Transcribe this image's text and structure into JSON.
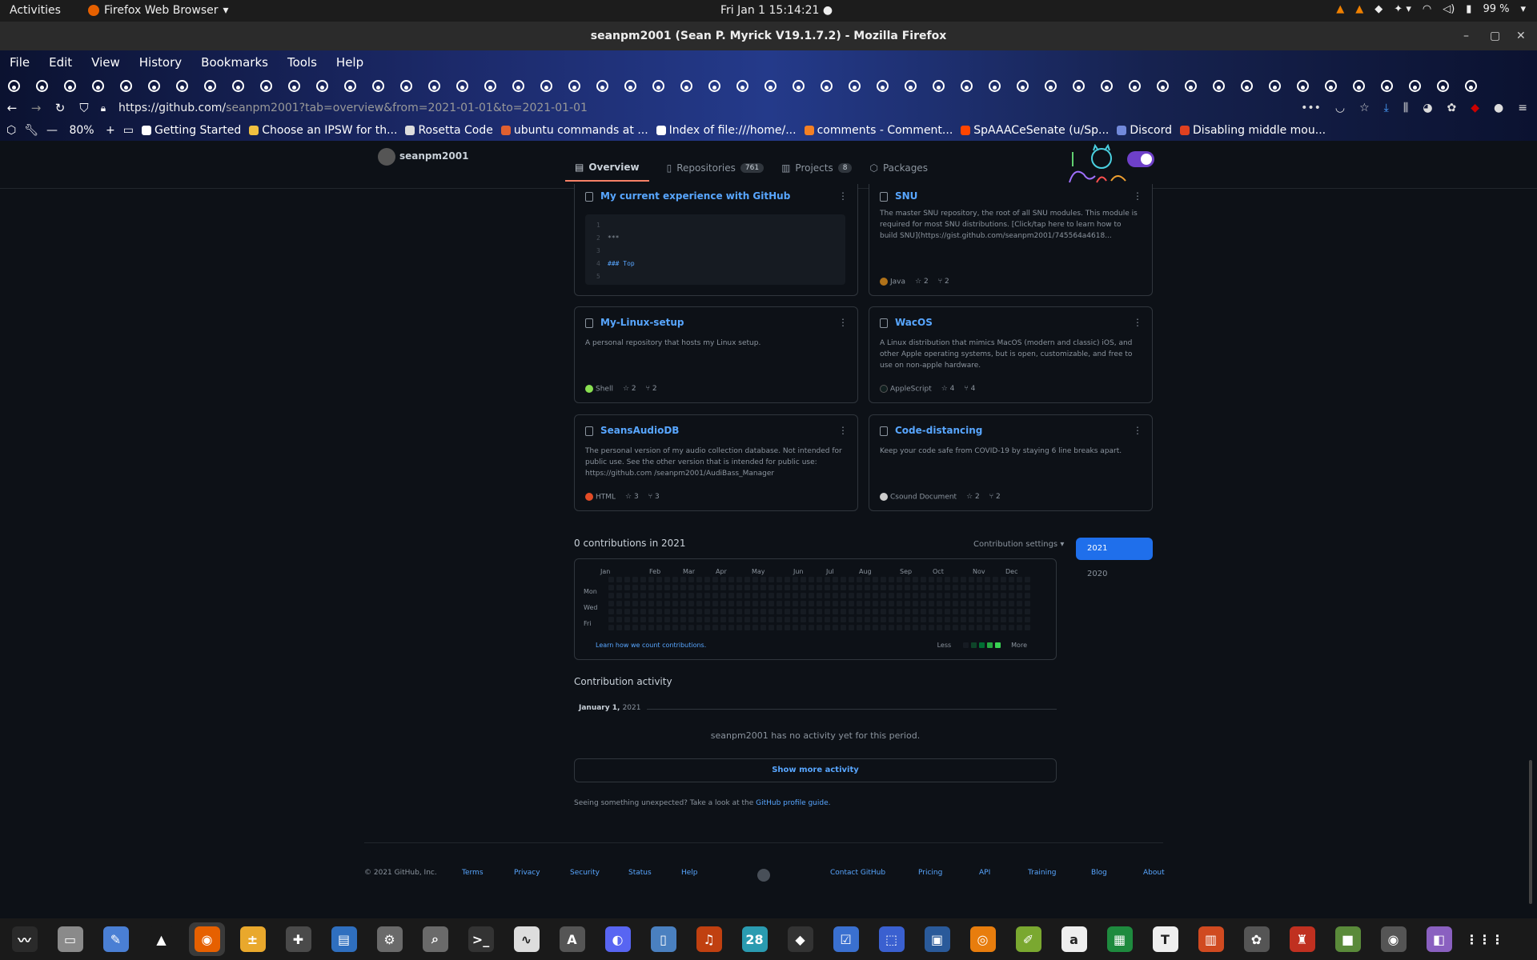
{
  "topbar": {
    "activities": "Activities",
    "app_name": "Firefox Web Browser",
    "clock": "Fri Jan 1  15:14:21",
    "battery": "99 %"
  },
  "window": {
    "title": "seanpm2001 (Sean P. Myrick V19.1.7.2) - Mozilla Firefox"
  },
  "menubar": [
    "File",
    "Edit",
    "View",
    "History",
    "Bookmarks",
    "Tools",
    "Help"
  ],
  "navbar": {
    "url_host": "https://github.com/",
    "url_path": "seanpm2001?tab=overview&from=2021-01-01&to=2021-01-01",
    "zoom": "80%"
  },
  "bookmarks": [
    {
      "label": "Getting Started",
      "color": "#ffffff"
    },
    {
      "label": "Choose an IPSW for th...",
      "color": "#f0c040"
    },
    {
      "label": "Rosetta Code",
      "color": "#dddddd"
    },
    {
      "label": "ubuntu commands at ...",
      "color": "#e06030"
    },
    {
      "label": "Index of file:///home/...",
      "color": "#ffffff"
    },
    {
      "label": "comments - Comment...",
      "color": "#f48024"
    },
    {
      "label": "SpAAACeSenate (u/Sp...",
      "color": "#ff4500"
    },
    {
      "label": "Discord",
      "color": "#7289da"
    },
    {
      "label": "Disabling middle mou...",
      "color": "#e04020"
    }
  ],
  "profile": {
    "username": "seanpm2001",
    "tabs": [
      {
        "label": "Overview"
      },
      {
        "label": "Repositories",
        "count": "761"
      },
      {
        "label": "Projects",
        "count": "8"
      },
      {
        "label": "Packages"
      }
    ]
  },
  "gist_card": {
    "title": "My current experience with GitHub",
    "lines": [
      {
        "n": "1",
        "text": ""
      },
      {
        "n": "2",
        "text": "***"
      },
      {
        "n": "3",
        "text": ""
      },
      {
        "n": "4",
        "text": "### Top"
      },
      {
        "n": "5",
        "text": ""
      }
    ]
  },
  "repos": [
    {
      "name": "SNU",
      "desc": "The master SNU repository, the root of all SNU modules. This module is required for most SNU distributions. [Click/tap here to learn how to build SNU](https://gist.github.com/seanpm2001/745564a4618...",
      "lang": "Java",
      "lang_color": "#b07219",
      "stars": "2",
      "forks": "2"
    },
    {
      "name": "My-Linux-setup",
      "desc": "A personal repository that hosts my Linux setup.",
      "lang": "Shell",
      "lang_color": "#89e051",
      "stars": "2",
      "forks": "2"
    },
    {
      "name": "WacOS",
      "desc": "A Linux distribution that mimics MacOS (modern and classic) iOS, and other Apple operating systems, but is open, customizable, and free to use on non-apple hardware.",
      "lang": "AppleScript",
      "lang_color": "#101f1f",
      "stars": "4",
      "forks": "4"
    },
    {
      "name": "SeansAudioDB",
      "desc": "The personal version of my audio collection database. Not intended for public use. See the other version that is intended for public use: https://github.com /seanpm2001/AudiBass_Manager",
      "lang": "HTML",
      "lang_color": "#e34c26",
      "stars": "3",
      "forks": "3"
    },
    {
      "name": "Code-distancing",
      "desc": "Keep your code safe from COVID-19 by staying 6 line breaks apart.",
      "lang": "Csound Document",
      "lang_color": "#cccccc",
      "stars": "2",
      "forks": "2"
    }
  ],
  "contributions": {
    "title": "0 contributions in 2021",
    "settings": "Contribution settings ▾",
    "months": [
      "Jan",
      "Feb",
      "Mar",
      "Apr",
      "May",
      "Jun",
      "Jul",
      "Aug",
      "Sep",
      "Oct",
      "Nov",
      "Dec"
    ],
    "days": [
      "Mon",
      "Wed",
      "Fri"
    ],
    "learn": "Learn how we count contributions.",
    "less": "Less",
    "more": "More",
    "legend_colors": [
      "#161b22",
      "#0e4429",
      "#006d32",
      "#26a641",
      "#39d353"
    ],
    "years": [
      "2021",
      "2020"
    ]
  },
  "activity": {
    "title": "Contribution activity",
    "date": "January 1,",
    "year": "2021",
    "empty": "seanpm2001 has no activity yet for this period.",
    "show_more": "Show more activity",
    "unexpected": "Seeing something unexpected? Take a look at the ",
    "guide": "GitHub profile guide."
  },
  "footer": {
    "copyright": "© 2021 GitHub, Inc.",
    "left_links": [
      "Terms",
      "Privacy",
      "Security",
      "Status",
      "Help"
    ],
    "right_links": [
      "Contact GitHub",
      "Pricing",
      "API",
      "Training",
      "Blog",
      "About"
    ]
  },
  "dock": [
    {
      "icon": "system-monitor-icon",
      "glyph": "〰",
      "bg": "#2a2a2a"
    },
    {
      "icon": "files-icon",
      "glyph": "▭",
      "bg": "#8a8a8a"
    },
    {
      "icon": "text-editor-icon",
      "glyph": "✎",
      "bg": "#4a7fd4"
    },
    {
      "icon": "vlc-icon",
      "glyph": "▲",
      "bg": "#1a1a1a"
    },
    {
      "icon": "firefox-icon",
      "glyph": "◉",
      "bg": "#e66000"
    },
    {
      "icon": "calculator-icon",
      "glyph": "±",
      "bg": "#e9a82c"
    },
    {
      "icon": "puzzle-icon",
      "glyph": "✚",
      "bg": "#4a4a4a"
    },
    {
      "icon": "document-icon",
      "glyph": "▤",
      "bg": "#2f6fbf"
    },
    {
      "icon": "settings-icon",
      "glyph": "⚙",
      "bg": "#6a6a6a"
    },
    {
      "icon": "search-icon",
      "glyph": "⌕",
      "bg": "#6a6a6a"
    },
    {
      "icon": "terminal-icon",
      "glyph": ">_",
      "bg": "#333333"
    },
    {
      "icon": "graph-icon",
      "glyph": "∿",
      "bg": "#dddddd"
    },
    {
      "icon": "appstore-icon",
      "glyph": "A",
      "bg": "#555555"
    },
    {
      "icon": "discord-icon",
      "glyph": "◐",
      "bg": "#5865f2"
    },
    {
      "icon": "book-icon",
      "glyph": "▯",
      "bg": "#4a80c0"
    },
    {
      "icon": "music-icon",
      "glyph": "♫",
      "bg": "#c04010"
    },
    {
      "icon": "calendar-icon",
      "glyph": "28",
      "bg": "#2a9bb0"
    },
    {
      "icon": "inkscape-icon",
      "glyph": "◆",
      "bg": "#333333"
    },
    {
      "icon": "tasks-icon",
      "glyph": "☑",
      "bg": "#3a70d0"
    },
    {
      "icon": "screenshot-icon",
      "glyph": "⬚",
      "bg": "#3a60d0"
    },
    {
      "icon": "virtualbox-icon",
      "glyph": "▣",
      "bg": "#2a5a9a"
    },
    {
      "icon": "blender-icon",
      "glyph": "◎",
      "bg": "#e87d0d"
    },
    {
      "icon": "draw-icon",
      "glyph": "✐",
      "bg": "#7aa830"
    },
    {
      "icon": "blank-doc-icon",
      "glyph": "a",
      "bg": "#eeeeee"
    },
    {
      "icon": "spreadsheet-icon",
      "glyph": "▦",
      "bg": "#1e8a3e"
    },
    {
      "icon": "typora-icon",
      "glyph": "T",
      "bg": "#eeeeee"
    },
    {
      "icon": "presentation-icon",
      "glyph": "▥",
      "bg": "#d04a20"
    },
    {
      "icon": "gimp-icon",
      "glyph": "✿",
      "bg": "#555555"
    },
    {
      "icon": "game-icon",
      "glyph": "♜",
      "bg": "#c03020"
    },
    {
      "icon": "minecraft-icon",
      "glyph": "■",
      "bg": "#5a8a3a"
    },
    {
      "icon": "webcam-icon",
      "glyph": "◉",
      "bg": "#555555"
    },
    {
      "icon": "tweaks-icon",
      "glyph": "◧",
      "bg": "#8a60c0"
    },
    {
      "icon": "app-grid-icon",
      "glyph": "⋮⋮⋮",
      "bg": "#1a1a1a"
    }
  ]
}
